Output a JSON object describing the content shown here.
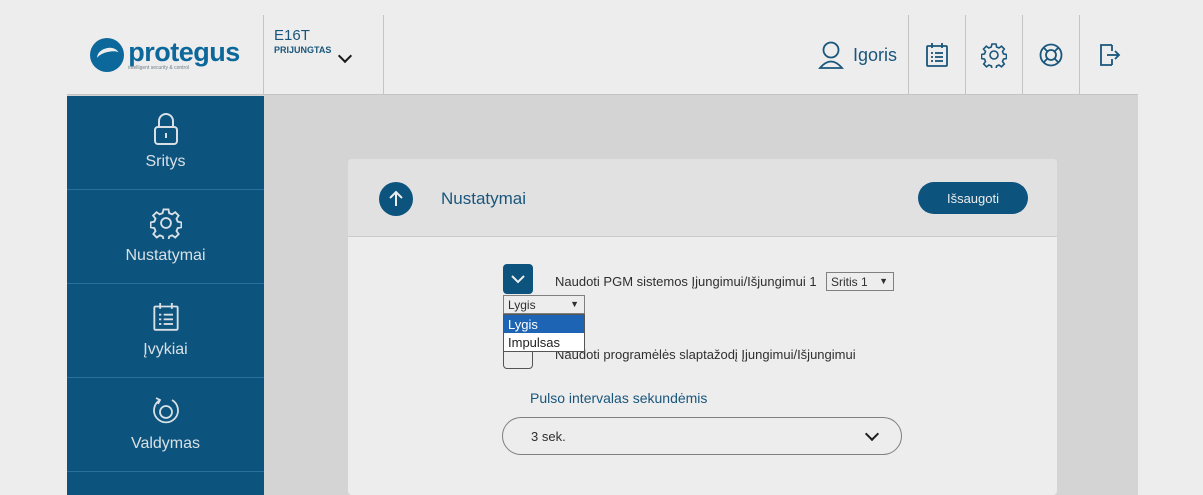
{
  "logo": {
    "word": "protegus",
    "tagline": "intelligent security & control"
  },
  "device": {
    "name": "E16T",
    "status": "PRIJUNGTAS"
  },
  "header": {
    "user_name": "Igoris",
    "buttons": [
      {
        "name": "events-calendar-icon"
      },
      {
        "name": "gear-icon"
      },
      {
        "name": "help-lifebuoy-icon"
      },
      {
        "name": "logout-icon"
      }
    ]
  },
  "sidebar": {
    "items": [
      {
        "label": "Sritys",
        "icon": "lock-icon"
      },
      {
        "label": "Nustatymai",
        "icon": "gear-icon"
      },
      {
        "label": "Įvykiai",
        "icon": "calendar-list-icon"
      },
      {
        "label": "Valdymas",
        "icon": "rotate-control-icon"
      }
    ]
  },
  "card": {
    "title": "Nustatymai",
    "save_label": "Išsaugoti",
    "option1": {
      "label": "Naudoti PGM sistemos Įjungimui/Išjungimui 1",
      "checked": true,
      "area_select": "Sritis 1"
    },
    "mode_select": {
      "value": "Lygis",
      "options": [
        "Lygis",
        "Impulsas"
      ]
    },
    "option2": {
      "label": "Naudoti programėlės slaptažodį Įjungimui/Išjungimui",
      "checked": false
    },
    "pulse": {
      "label": "Pulso intervalas sekundėmis",
      "value": "3 sek."
    }
  },
  "colors": {
    "primary": "#0d5a87",
    "brand": "#0d6fa6",
    "background": "#e5e5e5"
  }
}
